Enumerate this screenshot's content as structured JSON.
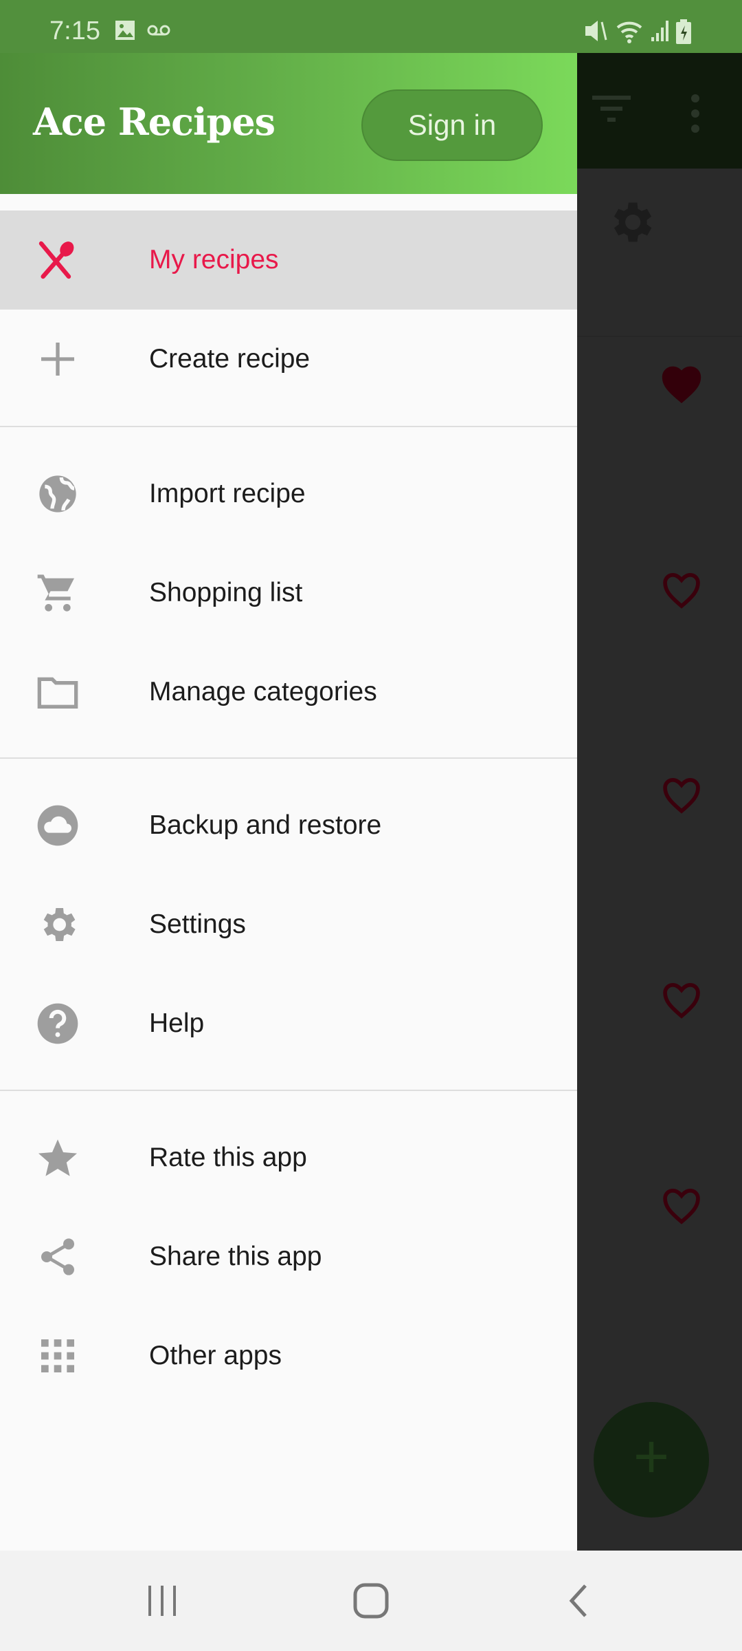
{
  "status_bar": {
    "time": "7:15",
    "icons": [
      "image-icon",
      "voicemail-icon",
      "mute-icon",
      "wifi-icon",
      "signal-icon",
      "battery-charging-icon"
    ]
  },
  "drawer": {
    "app_title": "Ace Recipes",
    "sign_in_label": "Sign in",
    "items": [
      {
        "label": "My recipes",
        "icon": "utensils-icon",
        "selected": true
      },
      {
        "label": "Create recipe",
        "icon": "plus-icon"
      },
      {
        "label": "Import recipe",
        "icon": "globe-icon"
      },
      {
        "label": "Shopping list",
        "icon": "cart-icon"
      },
      {
        "label": "Manage categories",
        "icon": "folder-icon"
      },
      {
        "label": "Backup and restore",
        "icon": "cloud-icon"
      },
      {
        "label": "Settings",
        "icon": "gear-icon"
      },
      {
        "label": "Help",
        "icon": "help-icon"
      },
      {
        "label": "Rate this app",
        "icon": "star-icon"
      },
      {
        "label": "Share this app",
        "icon": "share-icon"
      },
      {
        "label": "Other apps",
        "icon": "apps-grid-icon"
      }
    ]
  },
  "colors": {
    "accent": "#e8194a",
    "header_green": "#62ad48",
    "status_green": "#52903d"
  }
}
